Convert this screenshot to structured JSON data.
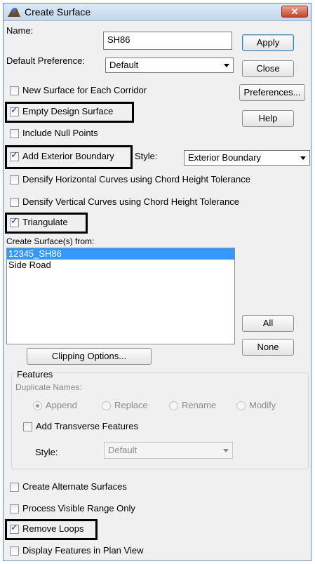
{
  "window": {
    "title": "Create Surface",
    "close_glyph": "✕"
  },
  "colors": {
    "selection": "#3399ff",
    "highlight_box": "#000000",
    "check": "#243a8c"
  },
  "name": {
    "label": "Name:",
    "value": "SH86"
  },
  "default_preference": {
    "label": "Default Preference:",
    "value": "Default"
  },
  "buttons": {
    "apply": "Apply",
    "close": "Close",
    "preferences": "Preferences...",
    "help": "Help",
    "all": "All",
    "none": "None",
    "clipping_options": "Clipping Options..."
  },
  "options": {
    "new_surface_each_corridor": {
      "label": "New Surface for Each Corridor",
      "checked": false
    },
    "empty_design_surface": {
      "label": "Empty Design Surface",
      "checked": true
    },
    "include_null_points": {
      "label": "Include Null Points",
      "checked": false
    },
    "add_exterior_boundary": {
      "label": "Add Exterior Boundary",
      "checked": true
    },
    "densify_horizontal": {
      "label": "Densify Horizontal Curves using Chord Height Tolerance",
      "checked": false
    },
    "densify_vertical": {
      "label": "Densify Vertical Curves using Chord Height Tolerance",
      "checked": false
    },
    "triangulate": {
      "label": "Triangulate",
      "checked": true
    }
  },
  "boundary_style": {
    "label": "Style:",
    "value": "Exterior Boundary"
  },
  "create_from": {
    "label": "Create Surface(s) from:",
    "items": [
      {
        "label": "12345_SH86",
        "selected": true
      },
      {
        "label": "Side Road",
        "selected": false
      }
    ]
  },
  "features": {
    "group_label": "Features",
    "duplicate_names_label": "Duplicate Names:",
    "radios": [
      {
        "label": "Append",
        "selected": true
      },
      {
        "label": "Replace",
        "selected": false
      },
      {
        "label": "Rename",
        "selected": false
      },
      {
        "label": "Modify",
        "selected": false
      }
    ],
    "add_transverse": {
      "label": "Add Transverse Features",
      "checked": false
    },
    "style_label": "Style:",
    "style_value": "Default"
  },
  "bottom_options": {
    "create_alternate": {
      "label": "Create Alternate Surfaces",
      "checked": false
    },
    "process_visible": {
      "label": "Process Visible Range Only",
      "checked": false
    },
    "remove_loops": {
      "label": "Remove Loops",
      "checked": true
    },
    "display_features": {
      "label": "Display Features in Plan View",
      "checked": false
    }
  }
}
